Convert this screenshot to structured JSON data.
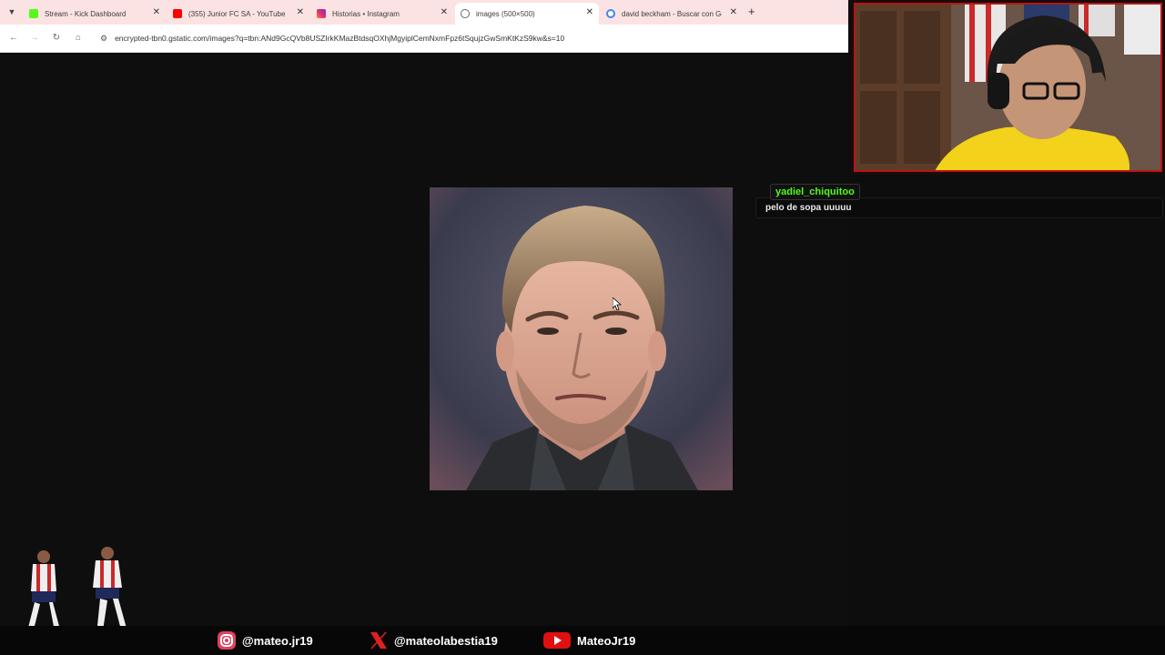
{
  "browser": {
    "tabs": [
      {
        "title": "Stream - Kick Dashboard",
        "favicon_color": "#53fc18",
        "active": false
      },
      {
        "title": "(355) Junior FC SA - YouTube",
        "favicon_color": "#ff0000",
        "active": false
      },
      {
        "title": "Historias • Instagram",
        "favicon_color": "#d6249f",
        "active": false
      },
      {
        "title": "images (500×500)",
        "favicon_color": "#666666",
        "active": true
      },
      {
        "title": "david beckham - Buscar con Go",
        "favicon_color": "#4285f4",
        "active": false
      }
    ],
    "address_bar": {
      "url": "encrypted-tbn0.gstatic.com/images?q=tbn:ANd9GcQVb8USZIrkKMazBtdsqOXhjMgyiplCemNxmFpz6tSqujzGwSmKtKzS9kw&s=10"
    }
  },
  "chat": {
    "username": "yadiel_chiquitoo",
    "message": "pelo de sopa uuuuu",
    "username_color": "#53fc18"
  },
  "socials": [
    {
      "platform": "instagram",
      "icon": "instagram-icon",
      "handle": "@mateo.jr19"
    },
    {
      "platform": "x",
      "icon": "x-icon",
      "handle": "@mateolabestia19"
    },
    {
      "platform": "youtube",
      "icon": "youtube-icon",
      "handle": "MateoJr19"
    }
  ],
  "colors": {
    "accent_red": "#b91515",
    "kick_green": "#53fc18"
  }
}
